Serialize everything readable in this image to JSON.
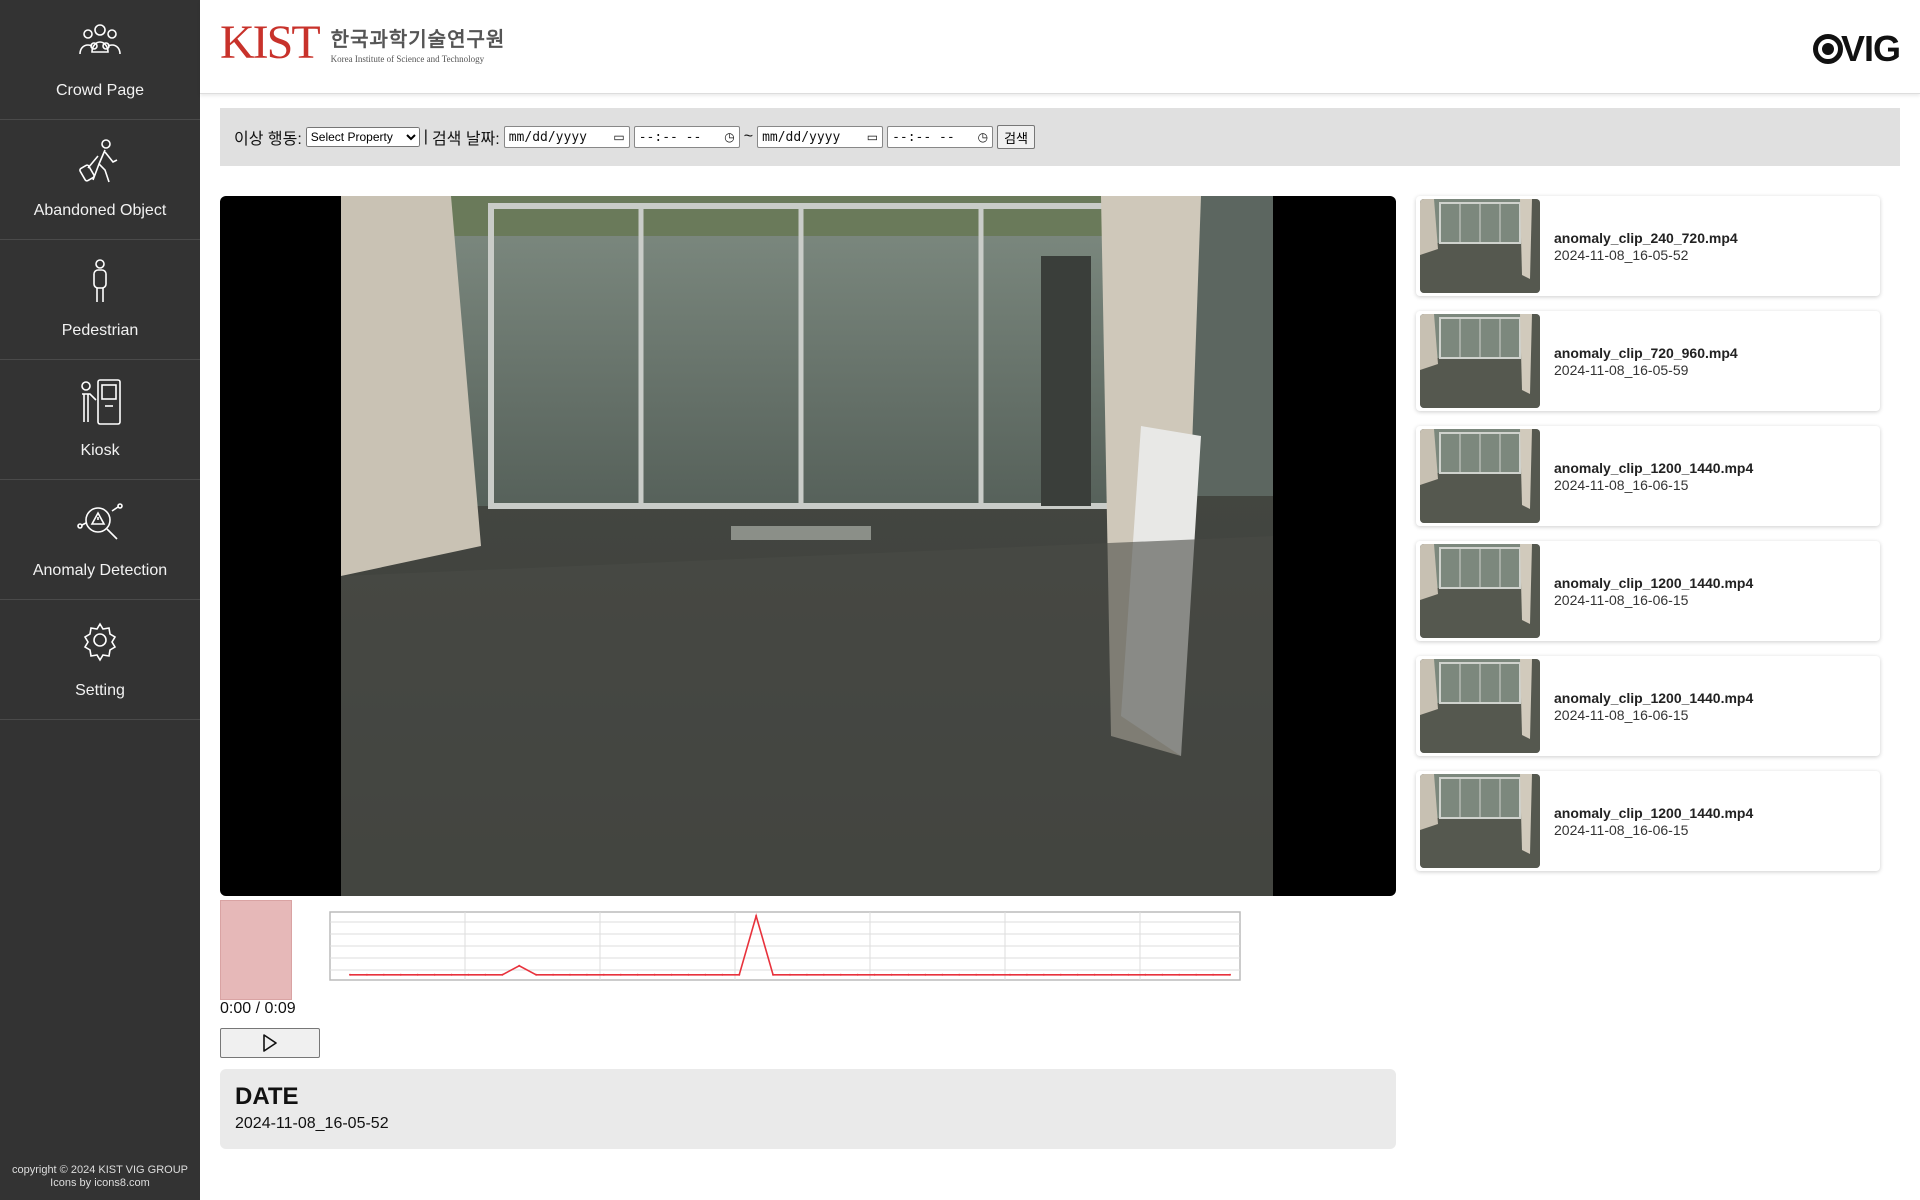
{
  "sidebar": {
    "items": [
      {
        "label": "Crowd Page",
        "icon": "crowd-icon"
      },
      {
        "label": "Abandoned Object",
        "icon": "person-luggage-icon"
      },
      {
        "label": "Pedestrian",
        "icon": "pedestrian-icon"
      },
      {
        "label": "Kiosk",
        "icon": "kiosk-icon"
      },
      {
        "label": "Anomaly Detection",
        "icon": "anomaly-search-icon"
      },
      {
        "label": "Setting",
        "icon": "gear-icon"
      }
    ],
    "copyright": "copyright © 2024 KIST VIG GROUP",
    "icons_credit": "Icons by icons8.com"
  },
  "header": {
    "logo_mark": "KIST",
    "logo_korean": "한국과학기술연구원",
    "logo_english": "Korea Institute of Science and Technology",
    "brand": "VIG"
  },
  "filter": {
    "anomaly_label": "이상 행동:",
    "select_value": "Select Property",
    "separator": "|",
    "date_label": "검색 날짜:",
    "date_from_placeholder": "mm/dd/yyyy",
    "time_from_placeholder": "--:-- --",
    "tilde": "~",
    "date_to_placeholder": "mm/dd/yyyy",
    "time_to_placeholder": "--:-- --",
    "search_button": "검색"
  },
  "player": {
    "timecode": "0:00 / 0:09",
    "play_icon": "play-icon"
  },
  "date_panel": {
    "title": "DATE",
    "value": "2024-11-08_16-05-52"
  },
  "clips": [
    {
      "name": "anomaly_clip_240_720.mp4",
      "time": "2024-11-08_16-05-52"
    },
    {
      "name": "anomaly_clip_720_960.mp4",
      "time": "2024-11-08_16-05-59"
    },
    {
      "name": "anomaly_clip_1200_1440.mp4",
      "time": "2024-11-08_16-06-15"
    },
    {
      "name": "anomaly_clip_1200_1440.mp4",
      "time": "2024-11-08_16-06-15"
    },
    {
      "name": "anomaly_clip_1200_1440.mp4",
      "time": "2024-11-08_16-06-15"
    },
    {
      "name": "anomaly_clip_1200_1440.mp4",
      "time": "2024-11-08_16-06-15"
    }
  ],
  "anomaly_graph": {
    "line_color": "#e8323c",
    "values": [
      0.02,
      0.02,
      0.02,
      0.02,
      0.02,
      0.02,
      0.02,
      0.02,
      0.02,
      0.02,
      0.17,
      0.02,
      0.02,
      0.02,
      0.02,
      0.02,
      0.02,
      0.02,
      0.02,
      0.02,
      0.02,
      0.02,
      0.02,
      0.02,
      1.0,
      0.02,
      0.02,
      0.02,
      0.02,
      0.02,
      0.02,
      0.02,
      0.02,
      0.02,
      0.02,
      0.02,
      0.02,
      0.02,
      0.02,
      0.02,
      0.02,
      0.02,
      0.02,
      0.02,
      0.02,
      0.02,
      0.02,
      0.02,
      0.02,
      0.02,
      0.02,
      0.02,
      0.02
    ]
  }
}
